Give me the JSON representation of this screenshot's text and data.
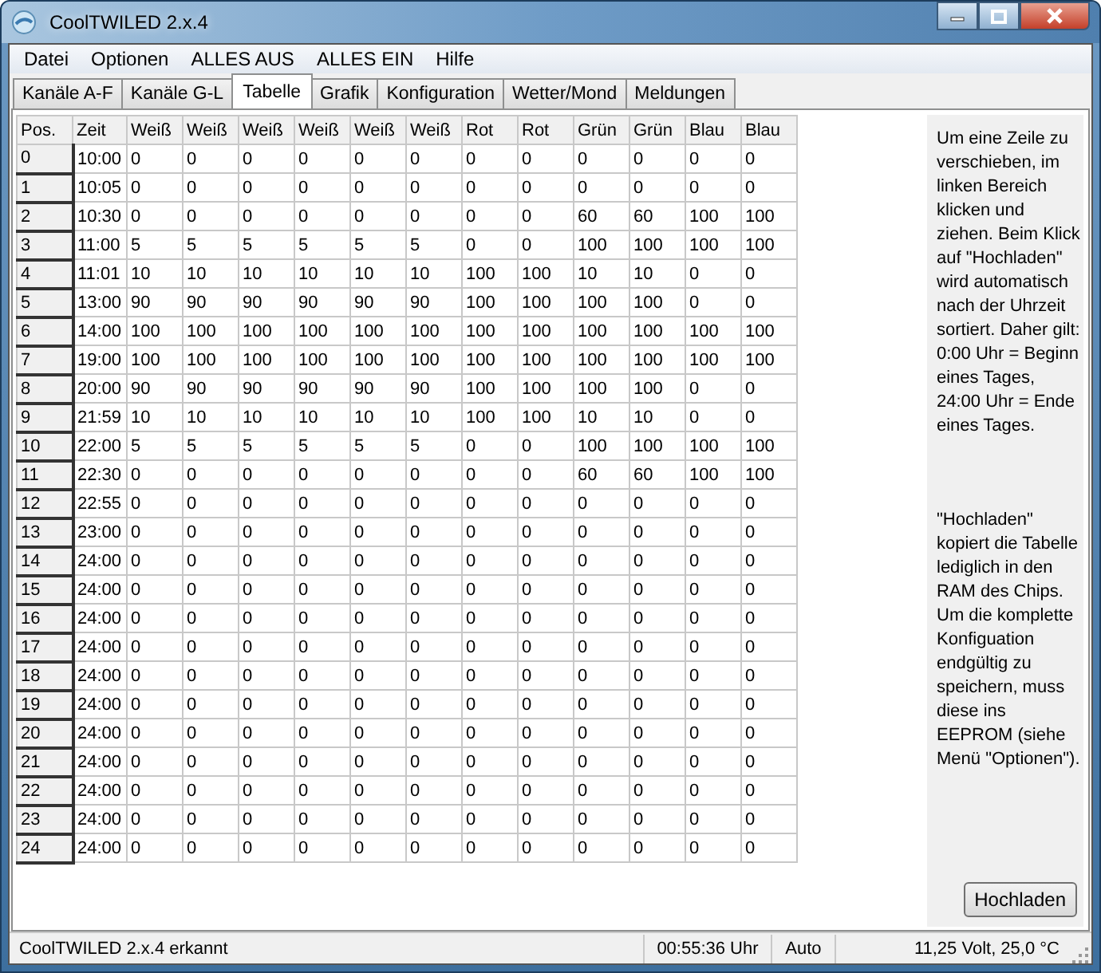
{
  "window": {
    "title": "CoolTWILED 2.x.4"
  },
  "menu": [
    "Datei",
    "Optionen",
    "ALLES AUS",
    "ALLES EIN",
    "Hilfe"
  ],
  "tabs": [
    {
      "label": "Kanäle A-F",
      "selected": false
    },
    {
      "label": "Kanäle G-L",
      "selected": false
    },
    {
      "label": "Tabelle",
      "selected": true
    },
    {
      "label": "Grafik",
      "selected": false
    },
    {
      "label": "Konfiguration",
      "selected": false
    },
    {
      "label": "Wetter/Mond",
      "selected": false
    },
    {
      "label": "Meldungen",
      "selected": false
    }
  ],
  "table": {
    "columns": [
      "Pos.",
      "Zeit",
      "Weiß",
      "Weiß",
      "Weiß",
      "Weiß",
      "Weiß",
      "Weiß",
      "Rot",
      "Rot",
      "Grün",
      "Grün",
      "Blau",
      "Blau"
    ],
    "rows": [
      [
        "0",
        "10:00",
        "0",
        "0",
        "0",
        "0",
        "0",
        "0",
        "0",
        "0",
        "0",
        "0",
        "0",
        "0"
      ],
      [
        "1",
        "10:05",
        "0",
        "0",
        "0",
        "0",
        "0",
        "0",
        "0",
        "0",
        "0",
        "0",
        "0",
        "0"
      ],
      [
        "2",
        "10:30",
        "0",
        "0",
        "0",
        "0",
        "0",
        "0",
        "0",
        "0",
        "60",
        "60",
        "100",
        "100"
      ],
      [
        "3",
        "11:00",
        "5",
        "5",
        "5",
        "5",
        "5",
        "5",
        "0",
        "0",
        "100",
        "100",
        "100",
        "100"
      ],
      [
        "4",
        "11:01",
        "10",
        "10",
        "10",
        "10",
        "10",
        "10",
        "100",
        "100",
        "10",
        "10",
        "0",
        "0"
      ],
      [
        "5",
        "13:00",
        "90",
        "90",
        "90",
        "90",
        "90",
        "90",
        "100",
        "100",
        "100",
        "100",
        "0",
        "0"
      ],
      [
        "6",
        "14:00",
        "100",
        "100",
        "100",
        "100",
        "100",
        "100",
        "100",
        "100",
        "100",
        "100",
        "100",
        "100"
      ],
      [
        "7",
        "19:00",
        "100",
        "100",
        "100",
        "100",
        "100",
        "100",
        "100",
        "100",
        "100",
        "100",
        "100",
        "100"
      ],
      [
        "8",
        "20:00",
        "90",
        "90",
        "90",
        "90",
        "90",
        "90",
        "100",
        "100",
        "100",
        "100",
        "0",
        "0"
      ],
      [
        "9",
        "21:59",
        "10",
        "10",
        "10",
        "10",
        "10",
        "10",
        "100",
        "100",
        "10",
        "10",
        "0",
        "0"
      ],
      [
        "10",
        "22:00",
        "5",
        "5",
        "5",
        "5",
        "5",
        "5",
        "0",
        "0",
        "100",
        "100",
        "100",
        "100"
      ],
      [
        "11",
        "22:30",
        "0",
        "0",
        "0",
        "0",
        "0",
        "0",
        "0",
        "0",
        "60",
        "60",
        "100",
        "100"
      ],
      [
        "12",
        "22:55",
        "0",
        "0",
        "0",
        "0",
        "0",
        "0",
        "0",
        "0",
        "0",
        "0",
        "0",
        "0"
      ],
      [
        "13",
        "23:00",
        "0",
        "0",
        "0",
        "0",
        "0",
        "0",
        "0",
        "0",
        "0",
        "0",
        "0",
        "0"
      ],
      [
        "14",
        "24:00",
        "0",
        "0",
        "0",
        "0",
        "0",
        "0",
        "0",
        "0",
        "0",
        "0",
        "0",
        "0"
      ],
      [
        "15",
        "24:00",
        "0",
        "0",
        "0",
        "0",
        "0",
        "0",
        "0",
        "0",
        "0",
        "0",
        "0",
        "0"
      ],
      [
        "16",
        "24:00",
        "0",
        "0",
        "0",
        "0",
        "0",
        "0",
        "0",
        "0",
        "0",
        "0",
        "0",
        "0"
      ],
      [
        "17",
        "24:00",
        "0",
        "0",
        "0",
        "0",
        "0",
        "0",
        "0",
        "0",
        "0",
        "0",
        "0",
        "0"
      ],
      [
        "18",
        "24:00",
        "0",
        "0",
        "0",
        "0",
        "0",
        "0",
        "0",
        "0",
        "0",
        "0",
        "0",
        "0"
      ],
      [
        "19",
        "24:00",
        "0",
        "0",
        "0",
        "0",
        "0",
        "0",
        "0",
        "0",
        "0",
        "0",
        "0",
        "0"
      ],
      [
        "20",
        "24:00",
        "0",
        "0",
        "0",
        "0",
        "0",
        "0",
        "0",
        "0",
        "0",
        "0",
        "0",
        "0"
      ],
      [
        "21",
        "24:00",
        "0",
        "0",
        "0",
        "0",
        "0",
        "0",
        "0",
        "0",
        "0",
        "0",
        "0",
        "0"
      ],
      [
        "22",
        "24:00",
        "0",
        "0",
        "0",
        "0",
        "0",
        "0",
        "0",
        "0",
        "0",
        "0",
        "0",
        "0"
      ],
      [
        "23",
        "24:00",
        "0",
        "0",
        "0",
        "0",
        "0",
        "0",
        "0",
        "0",
        "0",
        "0",
        "0",
        "0"
      ],
      [
        "24",
        "24:00",
        "0",
        "0",
        "0",
        "0",
        "0",
        "0",
        "0",
        "0",
        "0",
        "0",
        "0",
        "0"
      ]
    ]
  },
  "help": {
    "paragraphs": [
      "Um eine Zeile zu verschieben, im linken Bereich klicken und ziehen. Beim Klick auf \"Hochladen\" wird automatisch nach der Uhrzeit sortiert. Daher gilt: 0:00 Uhr = Beginn eines Tages, 24:00 Uhr = Ende eines Tages.",
      "\"Hochladen\" kopiert die Tabelle lediglich in den RAM des Chips. Um die komplette Konfiguation endgültig zu speichern, muss diese ins EEPROM (siehe Menü \"Optionen\")."
    ],
    "button": "Hochladen"
  },
  "status_bar": [
    "CoolTWILED 2.x.4 erkannt",
    "00:55:36 Uhr",
    "Auto",
    "11,25 Volt, 25,0 °C"
  ]
}
